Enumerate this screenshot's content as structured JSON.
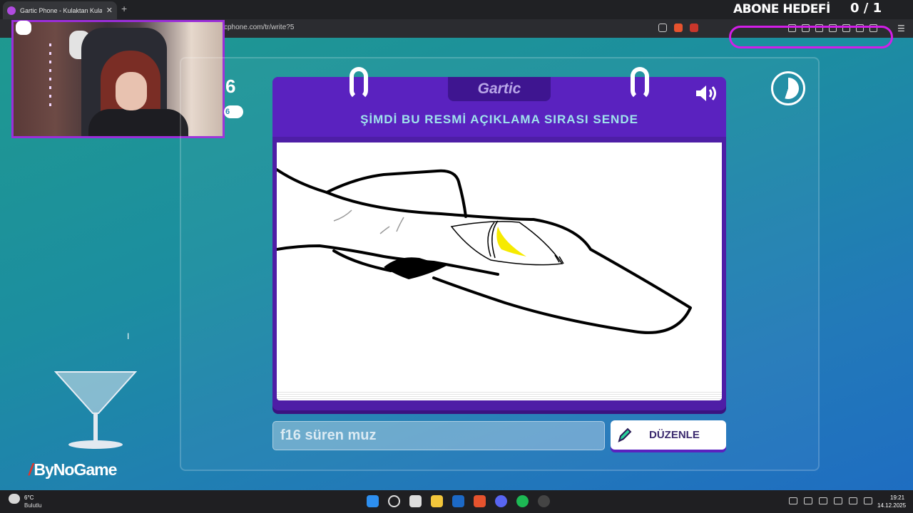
{
  "browser": {
    "tab_title": "Gartic Phone - Kulaktan Kulağa",
    "tab_close": "✕",
    "new_tab": "+",
    "url": "cphone.com/tr/write?5",
    "menu_icon": "kebab-menu-icon"
  },
  "overlay": {
    "subscriber_goal_label": "ABONE HEDEFİ",
    "subscriber_goal_value": "0 / 1"
  },
  "game": {
    "logo": "Gartic",
    "instruction": "ŞİMDİ BU RESMİ AÇIKLAMA SIRASI SENDE",
    "side_number": "6",
    "side_badge": "6",
    "answer_text": "f16 süren muz",
    "edit_button_label": "DÜZENLE",
    "speaker_icon": "speaker-icon",
    "timer_icon": "timer-icon",
    "colors": {
      "card": "#5a22bf",
      "instruction_text": "#9fe3ec",
      "banana": "#f6ea00"
    }
  },
  "sponsor": {
    "name": "ByNoGame"
  },
  "taskbar": {
    "weather_temp": "6°C",
    "weather_desc": "Bulutlu",
    "time": "19:21",
    "date": "14.12.2025"
  }
}
